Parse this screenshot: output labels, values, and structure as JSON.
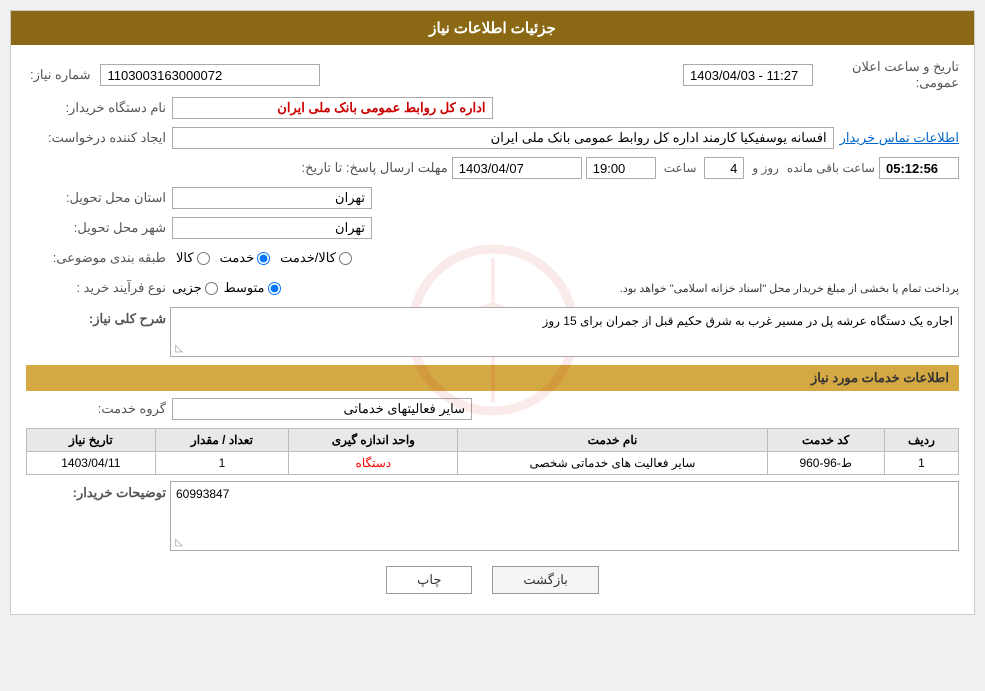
{
  "page": {
    "title": "جزئیات اطلاعات نیاز"
  },
  "header": {
    "announcement_label": "تاریخ و ساعت اعلان عمومی:",
    "announcement_value": "1403/04/03 - 11:27",
    "need_number_label": "شماره نیاز:",
    "need_number_value": "1103003163000072"
  },
  "buyer_org": {
    "label": "نام دستگاه خریدار:",
    "value": "اداره کل روابط عمومی بانک ملی ایران"
  },
  "creator": {
    "label": "ایجاد کننده درخواست:",
    "value": "افسانه یوسفیکیا کارمند اداره کل روابط عمومی بانک ملی ایران",
    "contact_link": "اطلاعات تماس خریدار"
  },
  "deadline": {
    "label": "مهلت ارسال پاسخ: تا تاریخ:",
    "date_value": "1403/04/07",
    "time_label": "ساعت",
    "time_value": "19:00",
    "days_label": "روز و",
    "days_value": "4",
    "remaining_label": "ساعت باقی مانده",
    "countdown_value": "05:12:56"
  },
  "province": {
    "label": "استان محل تحویل:",
    "value": "تهران"
  },
  "city": {
    "label": "شهر محل تحویل:",
    "value": "تهران"
  },
  "category": {
    "label": "طبقه بندی موضوعی:",
    "options": [
      "کالا",
      "خدمت",
      "کالا/خدمت"
    ],
    "selected": "خدمت"
  },
  "purchase_type": {
    "label": "نوع فرآیند خرید :",
    "options": [
      "جزیی",
      "متوسط"
    ],
    "description": "پرداخت تمام یا بخشی از مبلغ خریدار محل \"اسناد خزانه اسلامی\" خواهد بود.",
    "selected": "متوسط"
  },
  "need_summary": {
    "section_title": "شرح کلی نیاز:",
    "value": "اجاره یک دستگاه عرشه پل در مسیر غرب به شرق حکیم قبل از جمران برای 15 روز"
  },
  "services_section": {
    "title": "اطلاعات خدمات مورد نیاز"
  },
  "service_group": {
    "label": "گروه خدمت:",
    "value": "سایر فعالیتهای خدماتی"
  },
  "table": {
    "headers": [
      "ردیف",
      "کد خدمت",
      "نام خدمت",
      "واحد اندازه گیری",
      "تعداد / مقدار",
      "تاریخ نیاز"
    ],
    "rows": [
      {
        "row": "1",
        "code": "ط-96-960",
        "name": "سایر فعالیت های خدماتی شخصی",
        "unit": "دستگاه",
        "quantity": "1",
        "date": "1403/04/11"
      }
    ]
  },
  "buyer_notes": {
    "label": "توضیحات خریدار:",
    "value": "60993847"
  },
  "buttons": {
    "print": "چاپ",
    "back": "بازگشت"
  }
}
